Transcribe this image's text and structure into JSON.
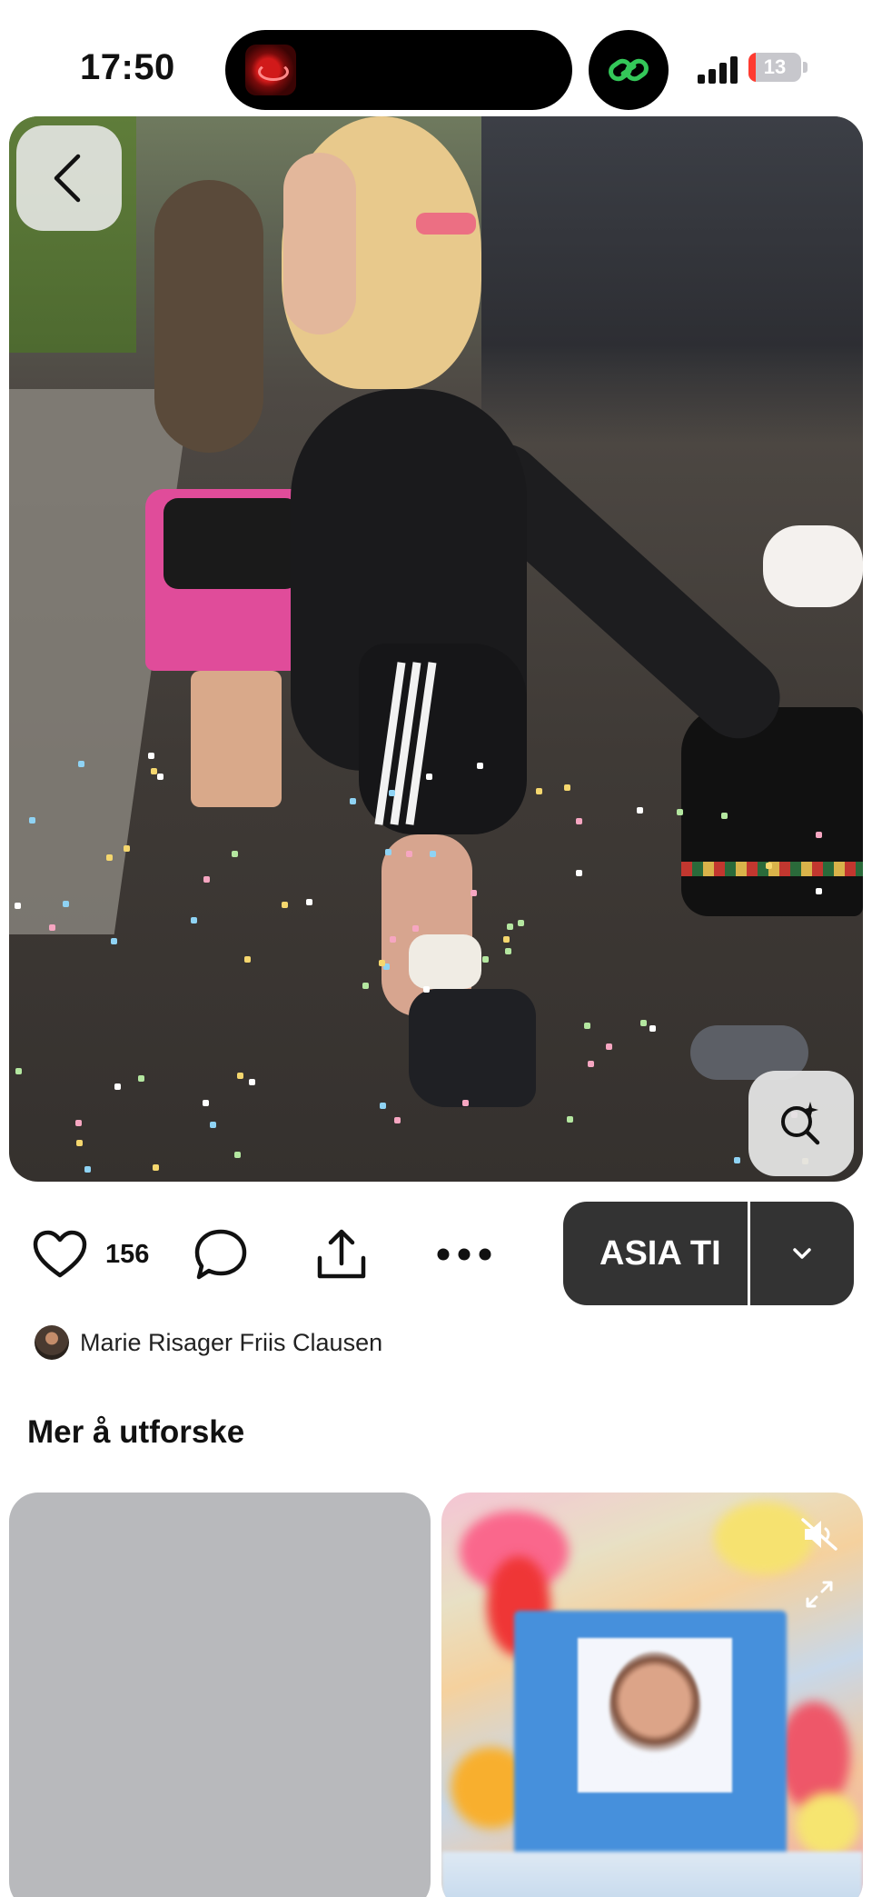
{
  "status_bar": {
    "time": "17:50",
    "battery_level": "13",
    "battery_percent": 13,
    "signal_bars": 4
  },
  "pin": {
    "image_description_icon": "photo",
    "back_icon": "chevron-left-icon",
    "visual_search_icon": "lens-sparkle-icon"
  },
  "actions": {
    "like_icon": "heart-icon",
    "like_count": "156",
    "comment_icon": "comment-bubble-icon",
    "share_icon": "share-upload-icon",
    "more_icon": "ellipsis-icon",
    "board_name": "ASIA TI",
    "board_dropdown_icon": "chevron-down-icon"
  },
  "author": {
    "name": "Marie Risager Friis Clausen"
  },
  "explore": {
    "title": "Mer å utforske",
    "video_mute_icon": "muted-speaker-icon",
    "video_expand_icon": "expand-arrows-icon"
  },
  "colors": {
    "save_button": "#333333",
    "island": "#000000",
    "link_icon": "#34c759",
    "battery_low": "#ff3b30",
    "placeholder_tile": "#b8b9bc"
  }
}
